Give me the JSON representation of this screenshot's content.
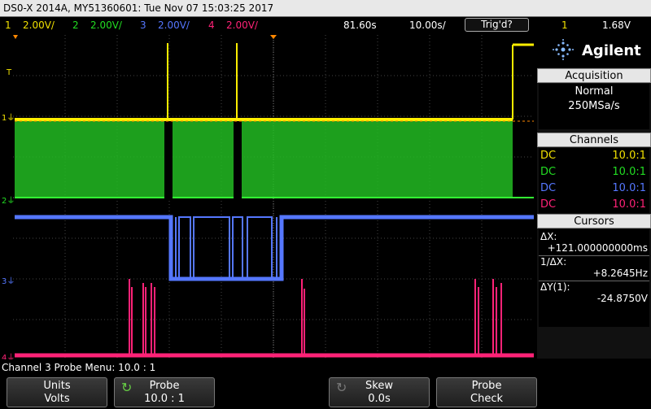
{
  "title": "DS0-X 2014A, MY51360601: Tue Nov 07 15:03:25 2017",
  "channels_bar": [
    {
      "num": "1",
      "scale": "2.00V/",
      "color": "#f0e000"
    },
    {
      "num": "2",
      "scale": "2.00V/",
      "color": "#22dd22"
    },
    {
      "num": "3",
      "scale": "2.00V/",
      "color": "#5577ff"
    },
    {
      "num": "4",
      "scale": "2.00V/",
      "color": "#ff2277"
    }
  ],
  "delay": "81.60s",
  "timebase": "10.00s/",
  "trigger_status": "Trig'd?",
  "trigger_source": "1",
  "trigger_level": "1.68V",
  "brand": "Agilent",
  "acquisition": {
    "header": "Acquisition",
    "mode": "Normal",
    "rate": "250MSa/s"
  },
  "channels_panel": {
    "header": "Channels",
    "rows": [
      {
        "coupling": "DC",
        "ratio": "10.0:1",
        "color": "#f0e000"
      },
      {
        "coupling": "DC",
        "ratio": "10.0:1",
        "color": "#22dd22"
      },
      {
        "coupling": "DC",
        "ratio": "10.0:1",
        "color": "#5577ff"
      },
      {
        "coupling": "DC",
        "ratio": "10.0:1",
        "color": "#ff2277"
      }
    ]
  },
  "cursors": {
    "header": "Cursors",
    "dx_label": "ΔX:",
    "dx_value": "+121.000000000ms",
    "inv_label": "1/ΔX:",
    "inv_value": "+8.2645Hz",
    "dy_label": "ΔY(1):",
    "dy_value": "-24.8750V"
  },
  "menu_title": "Channel 3 Probe Menu: 10.0 : 1",
  "softkeys": [
    {
      "top": "Units",
      "bottom": "Volts"
    },
    {
      "top": "Probe",
      "bottom": "10.0 : 1"
    },
    {
      "top": "Skew",
      "bottom": "0.0s"
    },
    {
      "top": "Probe",
      "bottom": "Check"
    }
  ],
  "colors": {
    "ch1": "#f0e000",
    "ch2": "#22dd22",
    "ch3": "#5577ff",
    "ch4": "#ff2277",
    "grid": "#555555"
  }
}
